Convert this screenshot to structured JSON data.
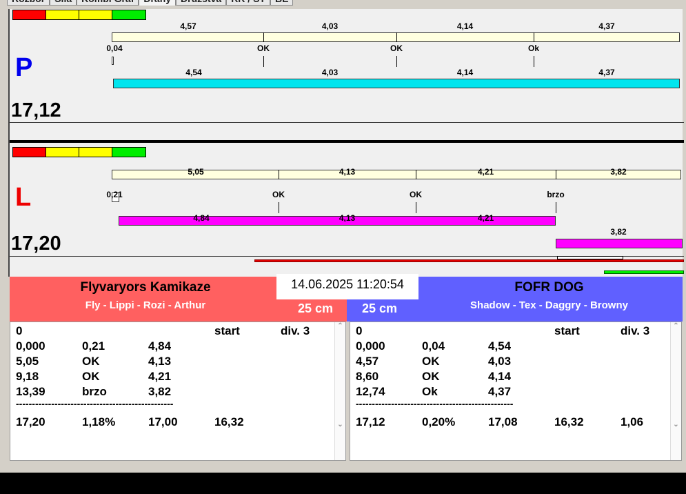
{
  "tabs": [
    "Rozbor",
    "Síla",
    "Kombi Graf",
    "Dráhy",
    "Družstva",
    "RR / ST",
    "BE"
  ],
  "colors": {
    "red": "#ff0000",
    "yellow": "#ffff00",
    "green": "#00e000",
    "cyan": "#00e5ee",
    "magenta": "#ff00ff",
    "left_team": "#ff6060",
    "right_team": "#6060ff"
  },
  "lane_p": {
    "letter": "P",
    "time": "17,12",
    "top_labels": [
      "4,57",
      "4,03",
      "4,14",
      "4,37"
    ],
    "status": [
      "0,04",
      "OK",
      "OK",
      "Ok"
    ],
    "bottom_labels": [
      "4,54",
      "4,03",
      "4,14",
      "4,37"
    ]
  },
  "lane_l": {
    "letter": "L",
    "time": "17,20",
    "top_labels": [
      "5,05",
      "4,13",
      "4,21",
      "3,82"
    ],
    "status": [
      "0,21",
      "OK",
      "OK",
      "brzo"
    ],
    "bottom_labels": [
      "4,84",
      "4,13",
      "4,21"
    ],
    "extra_label": "3,82"
  },
  "datetime": "14.06.2025 11:20:54",
  "left_team": {
    "name": "Flyvaryors Kamikaze",
    "dogs": "Fly - Lippi - Rozi - Arthur",
    "cm": "25 cm",
    "header": [
      "0",
      "",
      "",
      "start",
      "div. 3"
    ],
    "rows": [
      [
        "0,000",
        "0,21",
        "4,84"
      ],
      [
        "5,05",
        "OK",
        "4,13"
      ],
      [
        "9,18",
        "OK",
        "4,21"
      ],
      [
        "13,39",
        "brzo",
        "3,82"
      ]
    ],
    "separator": "-------------------------------------------------",
    "total": [
      "17,20",
      "1,18%",
      "17,00",
      "16,32",
      ""
    ]
  },
  "right_team": {
    "name": "FOFR DOG",
    "dogs": "Shadow - Tex - Daggry - Browny",
    "cm": "25 cm",
    "header": [
      "0",
      "",
      "",
      "start",
      "div. 3"
    ],
    "rows": [
      [
        "0,000",
        "0,04",
        "4,54"
      ],
      [
        "4,57",
        "OK",
        "4,03"
      ],
      [
        "8,60",
        "OK",
        "4,14"
      ],
      [
        "12,74",
        "Ok",
        "4,37"
      ]
    ],
    "separator": "-------------------------------------------------",
    "total": [
      "17,12",
      "0,20%",
      "17,08",
      "16,32",
      "1,06"
    ]
  }
}
